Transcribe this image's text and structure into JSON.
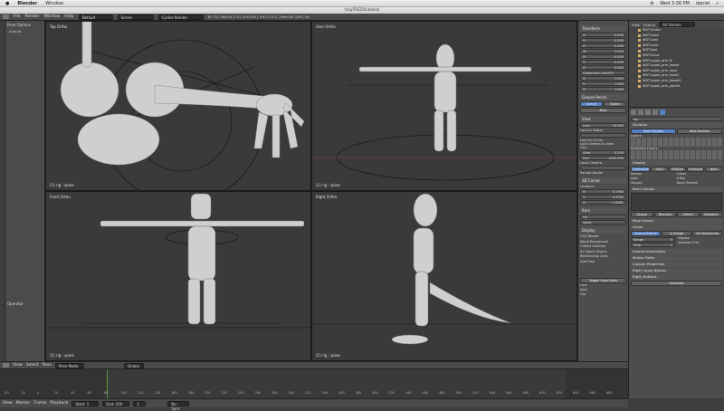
{
  "macbar": {
    "app": "Blender",
    "menu": [
      "Window"
    ],
    "clock": "Wed 3:36 PM",
    "user": "daniel"
  },
  "window_title": "tinyFREDO.blend",
  "info": {
    "menus": [
      "File",
      "Render",
      "Window",
      "Help"
    ],
    "layout": "Default",
    "scene": "Scene",
    "engine": "Cycles Render",
    "stats": "Bl: 74 | Verts:8,174 | Fa:6,944 | Tris:13,512 | Mem:45.32M | Fig"
  },
  "viewports": [
    {
      "label": "Top Ortho",
      "object": "(1) rig : spine"
    },
    {
      "label": "User Ortho",
      "object": "(1) rig : spine"
    },
    {
      "label": "Front Ortho",
      "object": "(1) rig : spine"
    },
    {
      "label": "Right Ortho",
      "object": "(1) rig : spine"
    }
  ],
  "toolshelf": {
    "title": "Pose Options",
    "item": "Auto IK",
    "bottom": "Operator"
  },
  "npanel": {
    "transform": "Transform",
    "location": [
      "0.000",
      "0.000",
      "0.000"
    ],
    "rotation": [
      "1.000",
      "0.000",
      "0.000",
      "0.000"
    ],
    "rotation_mode": "Quaternion (WXYZ)",
    "scale": [
      "1.000",
      "1.000",
      "1.000"
    ],
    "grease": "Grease Pencil",
    "scene_btn": "Scene",
    "object_btn": "Object",
    "new_btn": "New",
    "view": "View",
    "lens_label": "Lens",
    "lens": "35.000",
    "lock_to": "Lock to Object",
    "lock_cursor": "Lock to Cursor",
    "lock_cam": "Lock Camera to View",
    "clip": "Clip:",
    "start_label": "Start",
    "start": "0.100",
    "end_label": "End",
    "end": "1000.000",
    "local_cam": "Local Camera",
    "render_border": "Render Border",
    "cursor": "3D Cursor",
    "loc_label": "Location:",
    "cursor_loc": [
      "0.1764",
      "0.3762",
      "1.8361"
    ],
    "item": "Item",
    "item_fields": [
      "rig",
      "spine"
    ],
    "display": "Display",
    "disp_opts": [
      "Only Render",
      "World Background",
      "Outline Selected",
      "All Object Origins",
      "Relationship Lines"
    ],
    "grid_floor": "Grid Floor",
    "toggle_quad": "Toggle Quad View",
    "quad_opts": [
      "Lock",
      "Sync",
      "Clip"
    ]
  },
  "outliner": {
    "view": "View",
    "search": "Search",
    "scenes": "All Scenes",
    "items": [
      "WGT-tentac",
      "WGT-head",
      "WGT-clavi",
      "WGT-neck",
      "WGT-foot",
      "WGT-hand",
      "WGT-upper_arm_fk",
      "WGT-upper_arm_tweak",
      "WGT-upper_arm_hose",
      "WGT-upper_arm_hose2",
      "WGT-upper_arm_tweak2",
      "WGT-upper_arm_parent"
    ]
  },
  "properties": {
    "rig_label": "rig",
    "skeleton": "Skeleton",
    "pose_position": "Pose Position",
    "rest_position": "Rest Position",
    "layers": "Layers:",
    "protected": "Protected Layers:",
    "display": "Display",
    "display_modes": [
      "Octahedral",
      "Stick",
      "B-Bone",
      "Envelope",
      "Wire"
    ],
    "display_opts": [
      "Names",
      "Axes",
      "Shapes",
      "Colors",
      "X-Ray",
      "Delay Refresh"
    ],
    "bone_groups": "Bone Groups",
    "bone_group_btns": [
      "Assign",
      "Remove",
      "Select",
      "Deselect"
    ],
    "pose_library": "Pose Library",
    "ghost": "Ghost",
    "ghost_modes": [
      "Around Frame",
      "In Range",
      "On Keyframes"
    ],
    "range_label": "Range",
    "range": "0",
    "step_label": "Step",
    "step": "1",
    "display_label": "Display:",
    "selected_only": "Selected Only",
    "sections": [
      "Inverse Kinematics",
      "Motion Paths",
      "Custom Properties",
      "Rigify Layer Names",
      "Rigify Buttons"
    ],
    "generate": "Generate"
  },
  "header3d": {
    "menus": [
      "View",
      "Select",
      "Pose"
    ],
    "mode": "Pose Mode",
    "orientation": "Global"
  },
  "timeline": {
    "ticks": [
      "-40",
      "-20",
      "0",
      "20",
      "40",
      "60",
      "80",
      "100",
      "120",
      "140",
      "160",
      "180",
      "200",
      "220",
      "240",
      "260",
      "280",
      "300",
      "320",
      "340",
      "360",
      "380",
      "400",
      "420",
      "440",
      "460",
      "480",
      "500",
      "520",
      "540",
      "560",
      "580",
      "600",
      "620",
      "640",
      "660",
      "680"
    ],
    "menus": [
      "View",
      "Marker",
      "Frame",
      "Playback"
    ],
    "start_label": "Start:",
    "start": "1",
    "end_label": "End:",
    "end": "250",
    "current": "1",
    "sync": "No Sync"
  }
}
